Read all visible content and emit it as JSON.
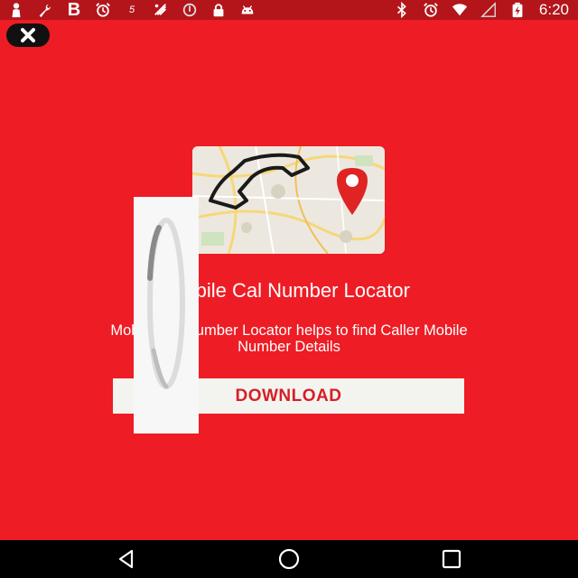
{
  "status_bar": {
    "left_icons": [
      "person-icon",
      "wrench-icon",
      "b-icon",
      "alarm-icon",
      "five-icon",
      "network-icon",
      "sync-icon",
      "lock-icon",
      "android-icon"
    ],
    "b_label": "B",
    "five_label": "5",
    "right_icons": [
      "bluetooth-icon",
      "alarm-icon",
      "wifi-icon",
      "signal-icon",
      "battery-icon"
    ],
    "time": "6:20"
  },
  "ad": {
    "close_icon": "close-icon",
    "image_icon": "map-phone-icon",
    "title": "Mobile Cal Number Locator",
    "description_line1": "Mobile Cal Number Locator helps to find Caller Mobile",
    "description_line2": "Number Details",
    "download_label": "DOWNLOAD"
  },
  "nav_bar": {
    "back_icon": "back-icon",
    "home_icon": "home-icon",
    "recents_icon": "recents-icon"
  },
  "colors": {
    "background": "#ee1c25",
    "status_bar": "#b3151b",
    "button_text": "#d51f26",
    "button_bg": "#f3f3ef"
  }
}
